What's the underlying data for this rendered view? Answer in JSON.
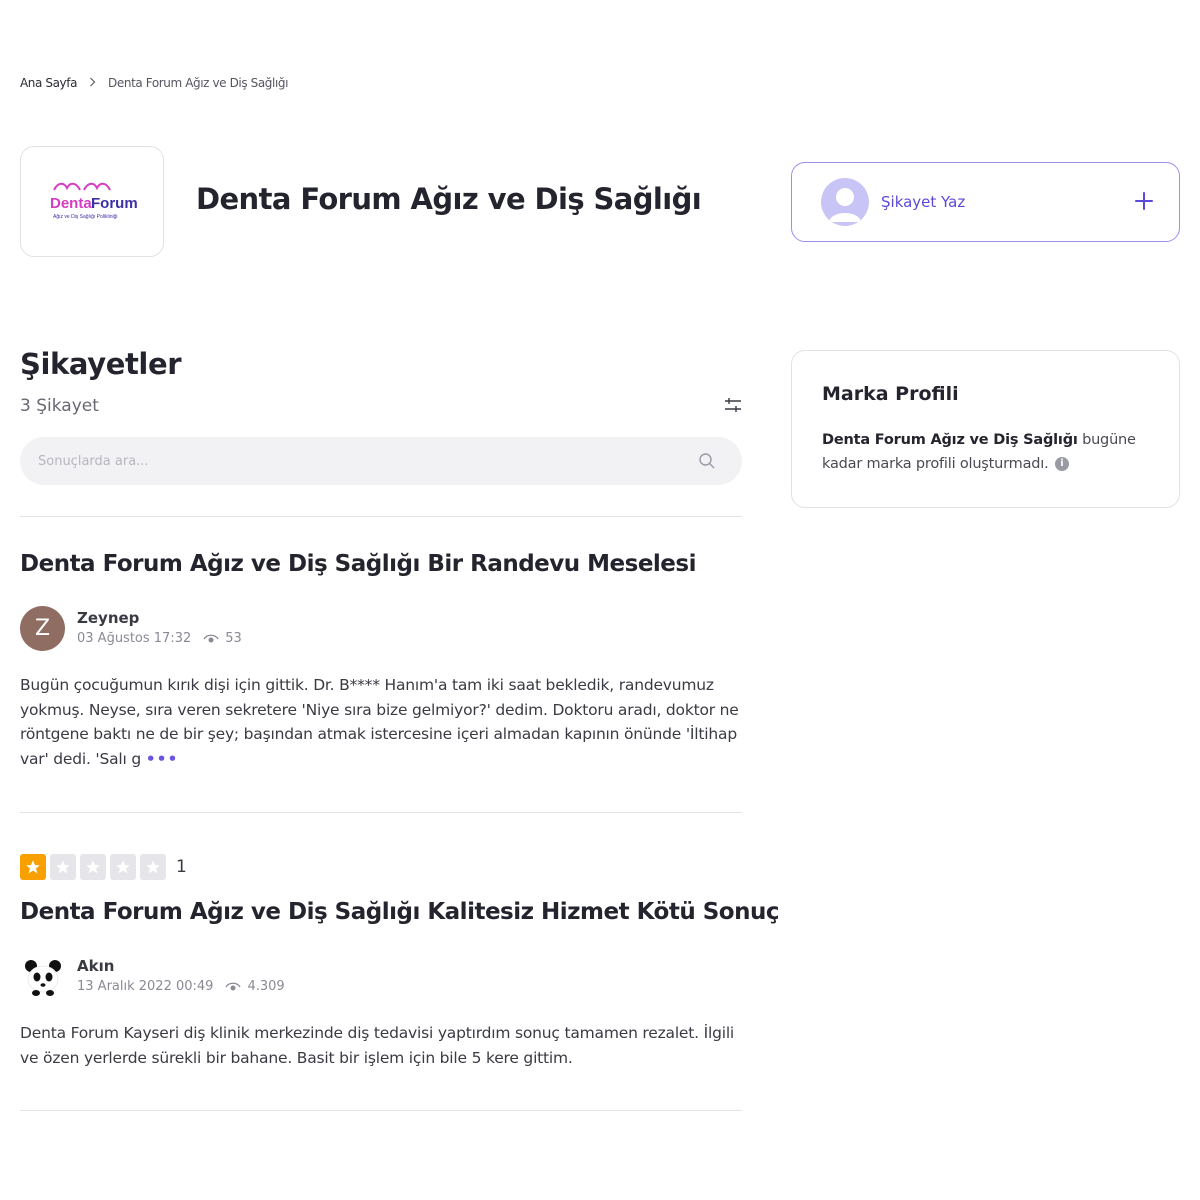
{
  "breadcrumb": {
    "home": "Ana Sayfa",
    "current": "Denta Forum Ağız ve Diş Sağlığı"
  },
  "brand": {
    "name": "Denta Forum Ağız ve Diş Sağlığı",
    "logo_main": "Denta Forum",
    "logo_sub": "Ağız ve Diş Sağlığı Polikliniği",
    "logo_color": "#7b3fd1"
  },
  "write_complaint": {
    "label": "Şikayet Yaz",
    "icon": "plus-icon"
  },
  "complaints_section": {
    "title": "Şikayetler",
    "count": "3 Şikayet",
    "search_placeholder": "Sonuçlarda ara..."
  },
  "complaints": [
    {
      "title": "Denta Forum Ağız ve Diş Sağlığı Bir Randevu Meselesi",
      "user": "Zeynep",
      "avatar_letter": "Z",
      "date": "03 Ağustos 17:32",
      "views": "53",
      "body": "Bugün çocuğumun kırık dişi için gittik. Dr. B**** Hanım'a tam iki saat bekledik, randevumuz yokmuş. Neyse, sıra veren sekretere 'Niye sıra bize gelmiyor?' dedim. Doktoru aradı, doktor ne röntgene baktı ne de bir şey; başından atmak istercesine içeri almadan kapının önünde 'İltihap var' dedi. 'Salı g",
      "more": "•••"
    },
    {
      "rating": 1,
      "rating_max": 5,
      "rating_label": "1",
      "title": "Denta Forum Ağız ve Diş Sağlığı Kalitesiz Hizmet Kötü Sonuç",
      "user": "Akın",
      "avatar_icon": "panda-avatar-icon",
      "date": "13 Aralık 2022 00:49",
      "views": "4.309",
      "body": "Denta Forum Kayseri diş klinik merkezinde diş tedavisi yaptırdım sonuç tamamen rezalet. İlgili ve özen yerlerde sürekli bir bahane. Basit bir işlem için bile 5 kere gittim."
    }
  ],
  "brand_profile": {
    "title": "Marka Profili",
    "brand_name": "Denta Forum Ağız ve Diş Sağlığı",
    "text": " bugüne kadar marka profili oluşturmadı."
  },
  "colors": {
    "accent": "#5b48d8",
    "star": "#f7a000",
    "avatar_z": "#8f6d62"
  }
}
